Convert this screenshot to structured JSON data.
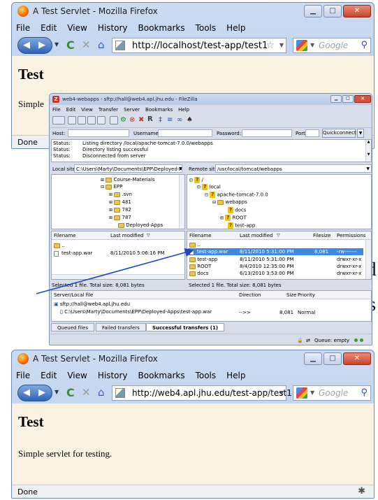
{
  "behind_text": {
    "t1": "t1",
    "d": "d",
    "ps": "ps"
  },
  "top_window": {
    "title": "A Test Servlet - Mozilla Firefox",
    "menu": [
      "File",
      "Edit",
      "View",
      "History",
      "Bookmarks",
      "Tools",
      "Help"
    ],
    "url": "http://localhost/test-app/test1",
    "search_placeholder": "Google",
    "heading": "Test",
    "text": "Simple",
    "status": "Done"
  },
  "bottom_window": {
    "title": "A Test Servlet - Mozilla Firefox",
    "menu": [
      "File",
      "Edit",
      "View",
      "History",
      "Bookmarks",
      "Tools",
      "Help"
    ],
    "url": "http://web4.apl.jhu.edu/test-app/test1",
    "search_placeholder": "Google",
    "heading": "Test",
    "text": "Simple servlet for testing.",
    "status": "Done"
  },
  "filezilla": {
    "title": "web4-webapps - sftp://hall@web4.apl.jhu.edu - FileZilla",
    "menu": [
      "File",
      "Edit",
      "View",
      "Transfer",
      "Server",
      "Bookmarks",
      "Help"
    ],
    "quickconnect": {
      "host_label": "Host:",
      "username_label": "Username:",
      "password_label": "Password:",
      "port_label": "Port:",
      "button": "Quickconnect"
    },
    "log": [
      {
        "label": "Status:",
        "text": "Listing directory /local/apache-tomcat-7.0.0/webapps"
      },
      {
        "label": "Status:",
        "text": "Directory listing successful"
      },
      {
        "label": "Status:",
        "text": "Disconnected from server"
      }
    ],
    "local_site_label": "Local site:",
    "local_path": "C:\\Users\\Marty\\Documents\\EPP\\Deployed-Apps\\",
    "remote_site_label": "Remote site:",
    "remote_path": "/usr/local/tomcat/webapps",
    "local_tree": [
      "Course-Materials",
      "EPP",
      ".svn",
      "481",
      "782",
      "787",
      "Deployed-Apps"
    ],
    "remote_tree": [
      "/",
      "local",
      "apache-tomcat-7.0.0",
      "webapps",
      "docs",
      "ROOT",
      "test-app"
    ],
    "local_headers": [
      "Filename",
      "Last modified"
    ],
    "local_files": [
      {
        "name": "..",
        "modified": ""
      },
      {
        "name": "test-app.war",
        "modified": "8/11/2010 5:06:16 PM"
      }
    ],
    "local_status": "Selected 1 file. Total size: 8,081 bytes",
    "remote_headers": [
      "Filename",
      "Last modified",
      "Filesize",
      "Permissions"
    ],
    "remote_files": [
      {
        "name": "..",
        "modified": "",
        "size": "",
        "perms": ""
      },
      {
        "name": "test-app.war",
        "modified": "8/11/2010 5:31:00 PM",
        "size": "8,081",
        "perms": "-rw-------"
      },
      {
        "name": "test-app",
        "modified": "8/11/2010 5:31:00 PM",
        "size": "",
        "perms": "drwxr-xr-x"
      },
      {
        "name": "ROOT",
        "modified": "8/4/2010 12:35:00 PM",
        "size": "",
        "perms": "drwxr-xr-x"
      },
      {
        "name": "docs",
        "modified": "6/13/2010 3:53:00 PM",
        "size": "",
        "perms": "drwxr-xr-x"
      }
    ],
    "remote_status": "Selected 1 file. Total size: 8,081 bytes",
    "queue_headers": [
      "Server/Local file",
      "Direction",
      "Size",
      "Priority"
    ],
    "queue_server": "sftp://hall@web4.apl.jhu.edu",
    "queue_file": "C:\\Users\\Marty\\Documents\\EPP\\Deployed-Apps\\test-app.war",
    "queue_direction": "-->>",
    "queue_size": "8,081",
    "queue_priority": "Normal",
    "queue_tabs": [
      "Queued files",
      "Failed transfers",
      "Successful transfers (1)"
    ],
    "queue_status": "Queue: empty"
  }
}
